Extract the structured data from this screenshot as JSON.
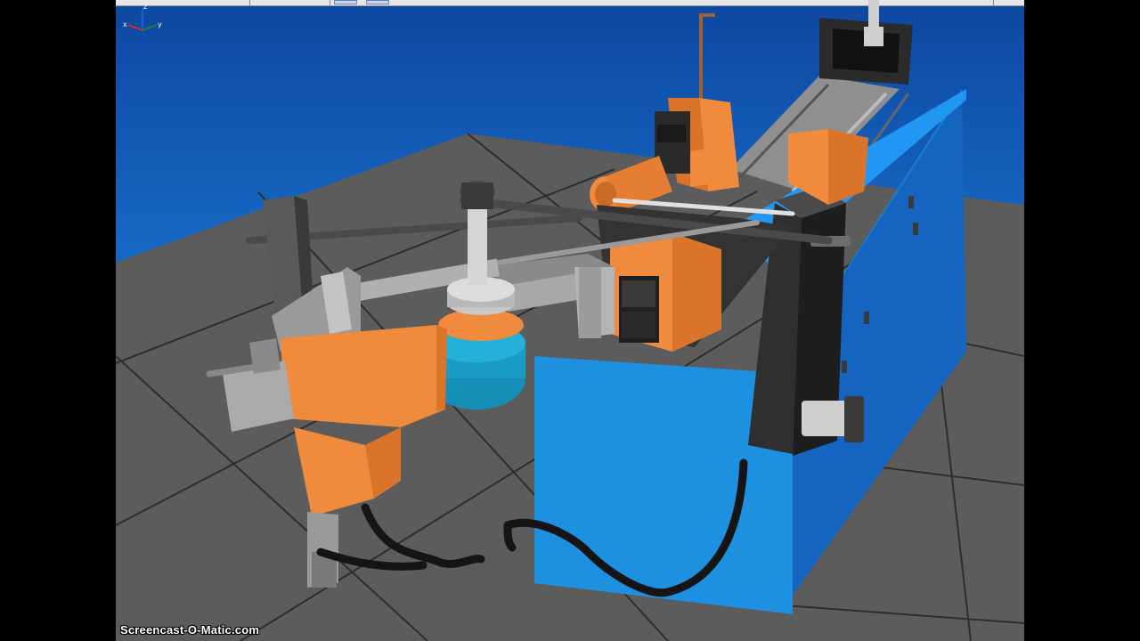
{
  "app": {
    "name": "3D CAD viewport",
    "watermark": "Screencast-O-Matic.com"
  },
  "triad": {
    "x_label": "x",
    "y_label": "y",
    "z_label": "z",
    "x_color": "#d32f2f",
    "y_color": "#2e7d32",
    "z_color": "#1565c0"
  },
  "colors": {
    "background_top": "#0d47a1",
    "background_bottom": "#1e88e5",
    "floor": "#5a5a5a",
    "machine_body": "#1e90e0",
    "accent_orange": "#f08a3c",
    "steel_gray": "#a0a0a0",
    "dark_gray": "#3a3a3a",
    "teal_motor": "#1a9cc4"
  },
  "icons": [
    "isometric-axes-icon"
  ]
}
